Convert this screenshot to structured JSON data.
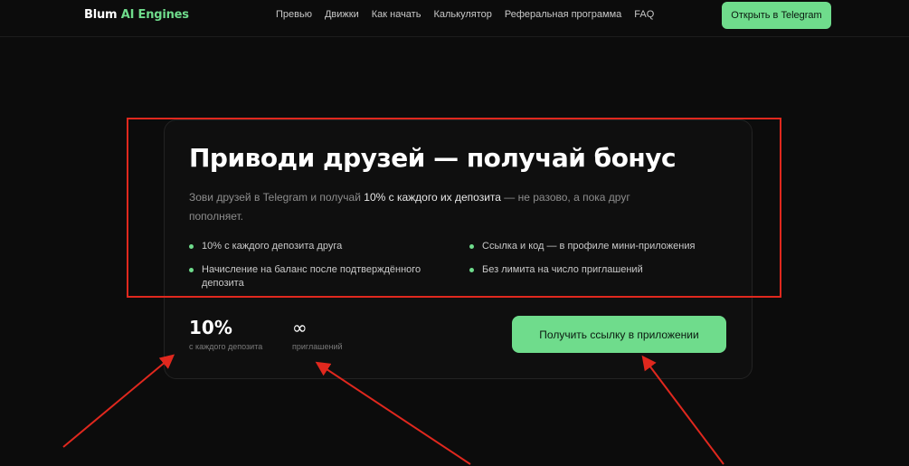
{
  "header": {
    "logo_main": "Blum",
    "logo_accent": "AI Engines",
    "nav": [
      "Превью",
      "Движки",
      "Как начать",
      "Калькулятор",
      "Реферальная программа",
      "FAQ"
    ],
    "cta_label": "Открыть в Telegram"
  },
  "referral": {
    "title": "Приводи друзей — получай бонус",
    "desc_before": "Зови друзей в Telegram и получай ",
    "desc_highlight": "10% с каждого их депозита",
    "desc_after": " — не разово, а пока друг пополняет.",
    "bullets_left": [
      "10% с каждого депозита друга",
      "Начисление на баланс после подтверждённого депозита"
    ],
    "bullets_right": [
      "Ссылка и код — в профиле мини-приложения",
      "Без лимита на число приглашений"
    ],
    "stats": [
      {
        "value": "10%",
        "label": "с каждого депозита"
      },
      {
        "value": "∞",
        "label": "приглашений"
      }
    ],
    "cta_label": "Получить ссылку в приложении"
  },
  "annotations": {
    "color": "#e0281e"
  },
  "colors": {
    "accent": "#6fdc8c",
    "background": "#0c0c0c"
  }
}
